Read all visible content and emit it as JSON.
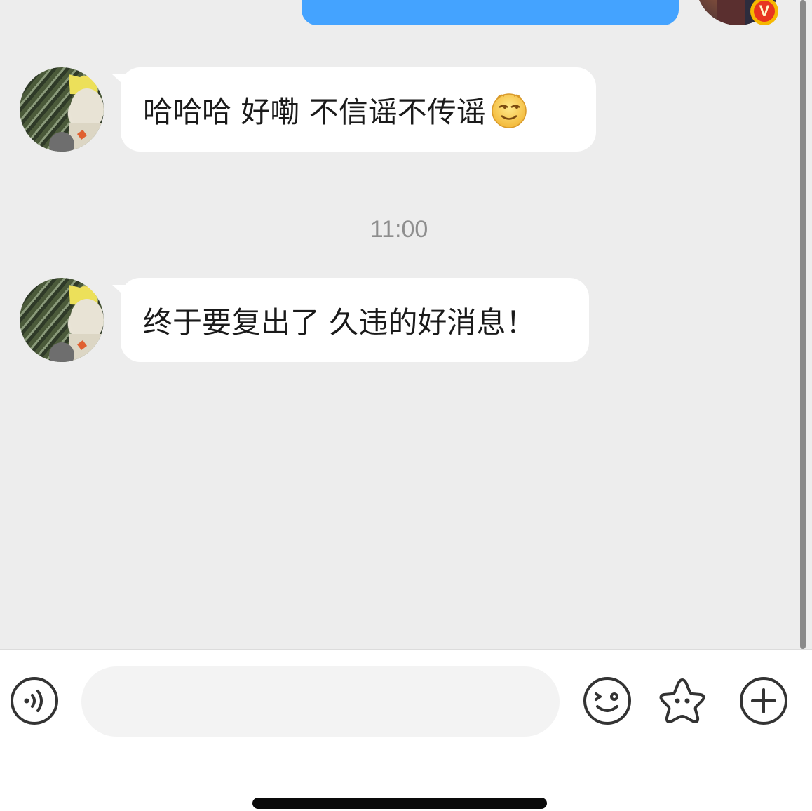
{
  "conversation": {
    "messages": [
      {
        "sender": "contact",
        "text": "哈哈哈 好嘞 不信谣不传谣",
        "emoji": "smug-face-emoji"
      },
      {
        "sender": "contact",
        "text": "终于要复出了 久违的好消息！"
      }
    ],
    "timestamp": "11:00",
    "self_avatar_badge": "V"
  },
  "input_bar": {
    "placeholder": "",
    "value": "",
    "icons": [
      "voice-icon",
      "sticker-wink-icon",
      "favorite-star-icon",
      "plus-icon"
    ]
  },
  "colors": {
    "sent_bubble": "#44a3ff",
    "received_bubble": "#ffffff",
    "chat_background": "#ededed",
    "badge_outer": "#f6b800",
    "badge_inner": "#e8351f"
  }
}
